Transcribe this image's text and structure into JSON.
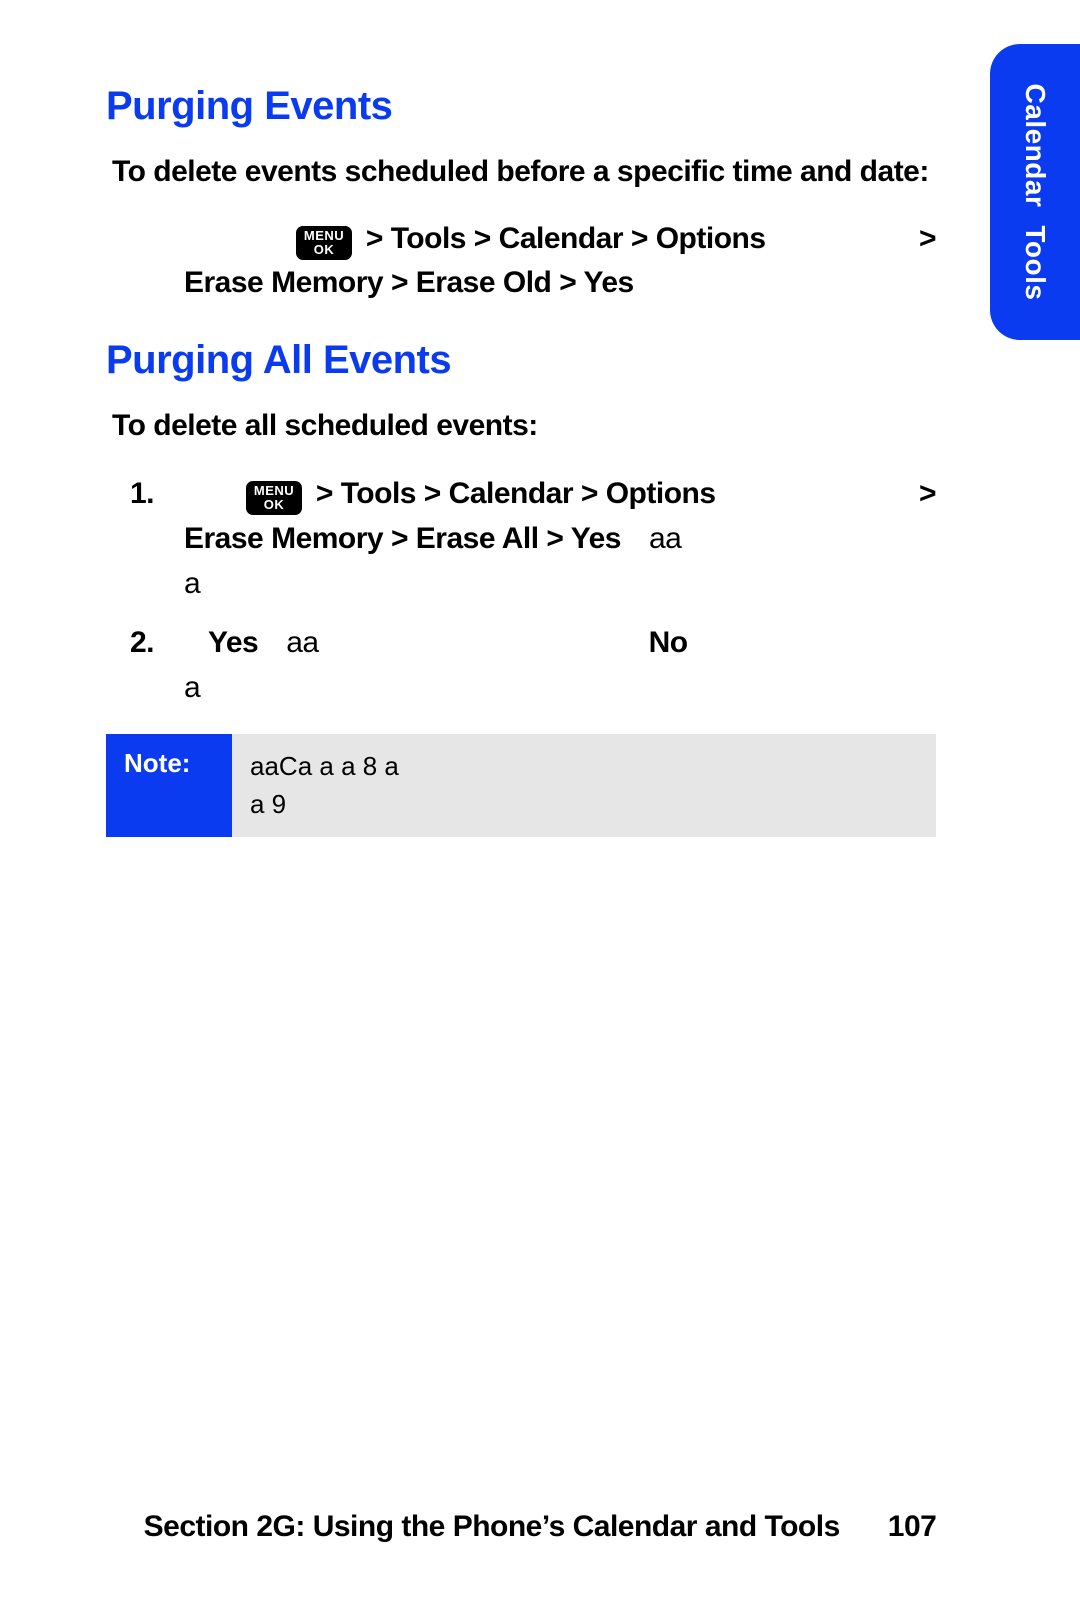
{
  "side_tab": {
    "line1": "Calendar",
    "line2": "Tools"
  },
  "section1": {
    "heading": "Purging Events",
    "intro": "To delete events scheduled before a specific time and date:",
    "menu_icon": {
      "top": "MENU",
      "bottom": "OK"
    },
    "path_line1": " > Tools > Calendar > Options",
    "path_line1_trail": ">",
    "path_line2": "Erase Memory > Erase Old > Yes"
  },
  "section2": {
    "heading": "Purging All Events",
    "intro": "To delete all scheduled events:",
    "steps": [
      {
        "num": "1.",
        "menu_icon": {
          "top": "MENU",
          "bottom": "OK"
        },
        "line1": " > Tools > Calendar > Options",
        "line1_trail": ">",
        "line2_a": "Erase Memory > Erase All > Yes",
        "line2_b": "aa",
        "line3": "a"
      },
      {
        "num": "2.",
        "line1_a": "Yes",
        "line1_b": "aa",
        "line1_c": "No",
        "line2": "a"
      }
    ]
  },
  "note": {
    "label": "Note:",
    "body_line1": "aaCa  a  a    8  a",
    "body_line2": "a   9"
  },
  "footer": {
    "text": "Section 2G: Using the Phone’s Calendar and Tools",
    "page": "107"
  }
}
